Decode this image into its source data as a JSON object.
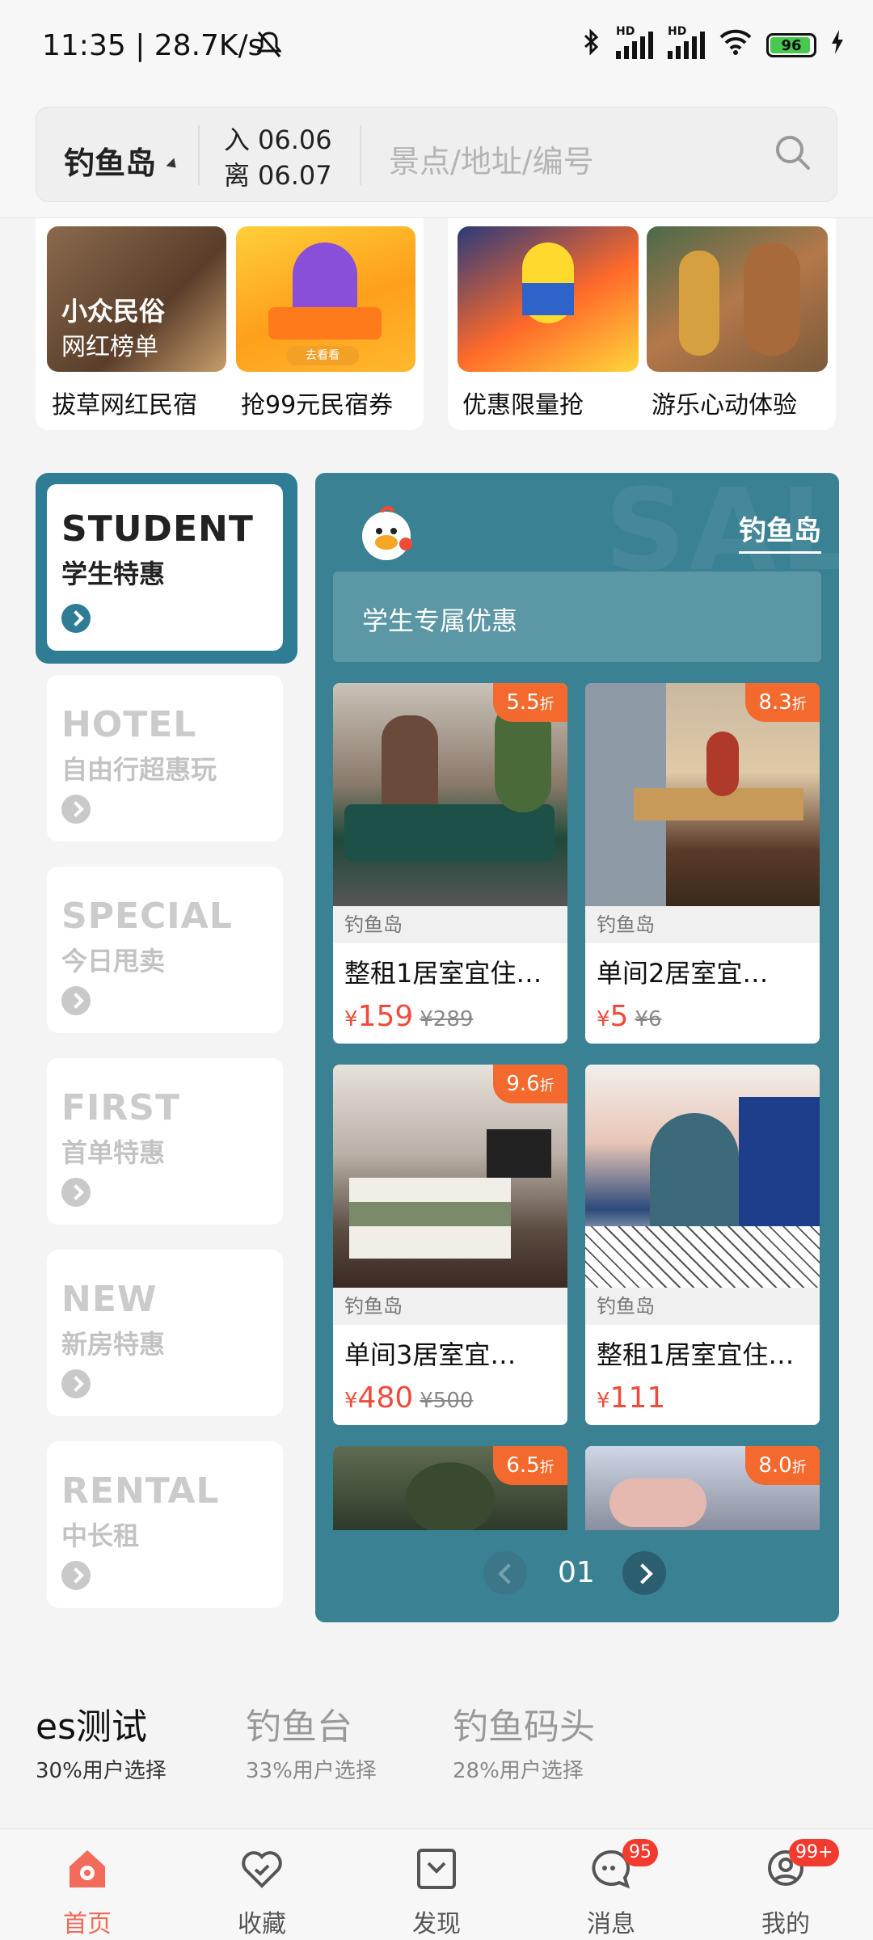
{
  "status_bar": {
    "time": "11:35 | 28.7K/s",
    "battery": "96"
  },
  "search": {
    "city": "钓鱼岛",
    "checkin_label": "入",
    "checkin_date": "06.06",
    "checkout_label": "离",
    "checkout_date": "06.07",
    "placeholder": "景点/地址/编号"
  },
  "top_cards": [
    {
      "badge_title": "小众民俗",
      "badge_sub": "网红榜单",
      "caption": "拔草网红民宿"
    },
    {
      "pill": "去看看",
      "caption": "抢99元民宿券"
    },
    {
      "caption": "优惠限量抢"
    },
    {
      "caption": "游乐心动体验"
    }
  ],
  "left_nav": [
    {
      "en": "STUDENT",
      "cn": "学生特惠",
      "active": true
    },
    {
      "en": "HOTEL",
      "cn": "自由行超惠玩"
    },
    {
      "en": "SPECIAL",
      "cn": "今日甩卖"
    },
    {
      "en": "FIRST",
      "cn": "首单特惠"
    },
    {
      "en": "NEW",
      "cn": "新房特惠"
    },
    {
      "en": "RENTAL",
      "cn": "中长租"
    }
  ],
  "panel": {
    "city": "钓鱼岛",
    "banner": "学生专属优惠",
    "products": [
      {
        "discount": "5.5",
        "unit": "折",
        "location": "钓鱼岛",
        "title": "整租1居室宜住…",
        "currency": "¥",
        "price": "159",
        "old_price": "¥289"
      },
      {
        "discount": "8.3",
        "unit": "折",
        "location": "钓鱼岛",
        "title": "单间2居室宜…",
        "currency": "¥",
        "price": "5",
        "old_price": "¥6"
      },
      {
        "discount": "9.6",
        "unit": "折",
        "location": "钓鱼岛",
        "title": "单间3居室宜…",
        "currency": "¥",
        "price": "480",
        "old_price": "¥500"
      },
      {
        "discount": "",
        "unit": "",
        "location": "钓鱼岛",
        "title": "整租1居室宜住…",
        "currency": "¥",
        "price": "111",
        "old_price": ""
      },
      {
        "discount": "6.5",
        "unit": "折"
      },
      {
        "discount": "8.0",
        "unit": "折"
      }
    ],
    "page": "01"
  },
  "destinations": [
    {
      "name": "es测试",
      "pct": "30%用户选择"
    },
    {
      "name": "钓鱼台",
      "pct": "33%用户选择"
    },
    {
      "name": "钓鱼码头",
      "pct": "28%用户选择"
    }
  ],
  "tabs": [
    {
      "label": "首页",
      "icon": "home-icon"
    },
    {
      "label": "收藏",
      "icon": "heart-icon"
    },
    {
      "label": "发现",
      "icon": "discover-icon"
    },
    {
      "label": "消息",
      "icon": "message-icon",
      "badge": "95"
    },
    {
      "label": "我的",
      "icon": "profile-icon",
      "badge": "99+"
    }
  ],
  "colors": {
    "accent": "#3a8193",
    "price": "#f24a3a",
    "discount": "#f46a2e",
    "tab_active": "#f06a5a"
  }
}
